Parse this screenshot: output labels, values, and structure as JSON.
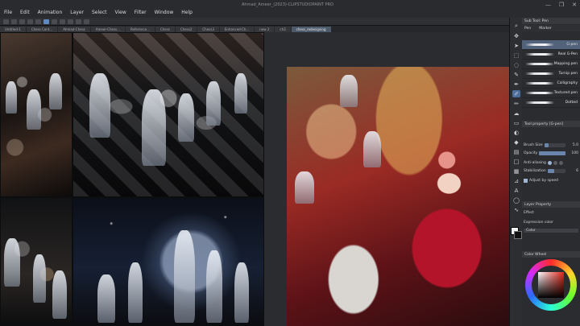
{
  "window": {
    "title": "Ahmad_Ameer_(2023)-CLIPSTUDIOPAINT PRO",
    "controls": [
      "—",
      "❐",
      "✕"
    ]
  },
  "menu": [
    "File",
    "Edit",
    "Animation",
    "Layer",
    "Select",
    "View",
    "Filter",
    "Window",
    "Help"
  ],
  "tabs": [
    {
      "label": "Untitled-1",
      "active": false
    },
    {
      "label": "Chess Cont...",
      "active": false
    },
    {
      "label": "Ahmad-Chess",
      "active": false
    },
    {
      "label": "Ameer-Chess...",
      "active": false
    },
    {
      "label": "Reference...",
      "active": false
    },
    {
      "label": "Chess",
      "active": false
    },
    {
      "label": "Chess2",
      "active": false
    },
    {
      "label": "Chess3",
      "active": false
    },
    {
      "label": "Enhanced-Ch...",
      "active": false
    },
    {
      "label": "new 2",
      "active": false
    },
    {
      "label": "ch3",
      "active": false
    },
    {
      "label": "chess_redesigning",
      "active": true
    }
  ],
  "panels": {
    "brush_header": "Sub Tool: Pen",
    "brush_tabs": [
      "Pen",
      "Marker"
    ],
    "brushes": [
      {
        "name": "G-pen",
        "selected": true
      },
      {
        "name": "Real G-Pen",
        "selected": false
      },
      {
        "name": "Mapping pen",
        "selected": false
      },
      {
        "name": "Turnip pen",
        "selected": false
      },
      {
        "name": "Calligraphy",
        "selected": false
      },
      {
        "name": "Textured pen",
        "selected": false
      },
      {
        "name": "Dotted",
        "selected": false
      }
    ],
    "tool_property_header": "Tool property [G-pen]",
    "brush_size_label": "Brush Size",
    "brush_size_value": "5.0",
    "brush_size_fill": 0.2,
    "opacity_label": "Opacity",
    "opacity_value": "100",
    "opacity_fill": 1.0,
    "anti_alias_label": "Anti-aliasing",
    "stabilization_label": "Stabilization",
    "stabilization_value": "6",
    "stabilization_fill": 0.35,
    "adjust_speed_label": "Adjust by speed",
    "layer_property_header": "Layer Property",
    "effect_label": "Effect",
    "expression_color_label": "Expression color",
    "expression_color_value": "Color",
    "color_header": "Color Wheel"
  },
  "colors": {
    "accent": "#4b6e9c",
    "selected_brush": "#51627a",
    "current_color": "#e1261c"
  }
}
